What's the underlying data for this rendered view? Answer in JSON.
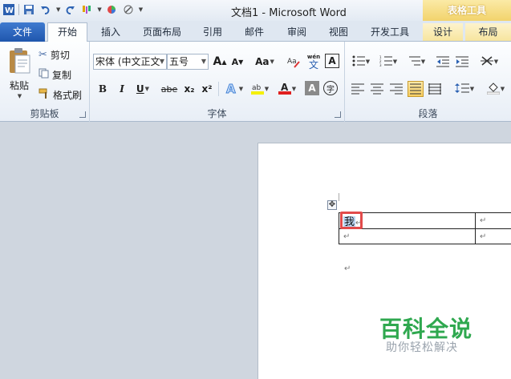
{
  "window": {
    "title": "文档1 - Microsoft Word",
    "context_title": "表格工具"
  },
  "tabs": [
    {
      "label": "文件"
    },
    {
      "label": "开始"
    },
    {
      "label": "插入"
    },
    {
      "label": "页面布局"
    },
    {
      "label": "引用"
    },
    {
      "label": "邮件"
    },
    {
      "label": "审阅"
    },
    {
      "label": "视图"
    },
    {
      "label": "开发工具"
    },
    {
      "label": "设计"
    },
    {
      "label": "布局"
    }
  ],
  "clipboard": {
    "paste": "粘贴",
    "cut": "剪切",
    "copy": "复制",
    "format_painter": "格式刷",
    "label": "剪贴板"
  },
  "font": {
    "font_name": "宋体 (中文正文",
    "font_size": "五号",
    "label": "字体",
    "grow": "A",
    "shrink": "A",
    "case": "Aa",
    "bold": "B",
    "italic": "I",
    "underline": "U",
    "strike": "abe",
    "sub": "x₂",
    "sup": "x²",
    "char_shade": "A",
    "enclose": "字",
    "phonetic": "wén",
    "phonetic_char": "文"
  },
  "paragraph": {
    "label": "段落"
  },
  "document": {
    "cell_text": "我",
    "mark": "↵"
  },
  "watermark": {
    "brand": "百科全说",
    "slogan": "助你轻松解决"
  },
  "colors": {
    "file_tab": "#2a63bd",
    "context_tab": "#f2d36c",
    "highlight_box": "#e24b4b",
    "brand_green": "#2fa84f"
  }
}
